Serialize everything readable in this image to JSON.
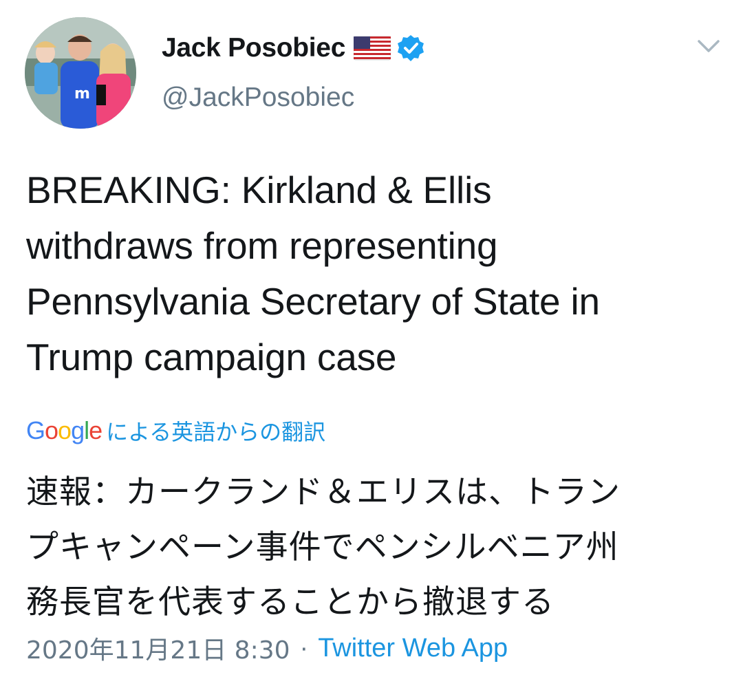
{
  "author": {
    "display_name": "Jack Posobiec",
    "handle": "@JackPosobiec",
    "flag_icon": "us-flag-icon",
    "verified_icon": "verified-badge-icon"
  },
  "tweet": {
    "text_lines": [
      "BREAKING: Kirkland & Ellis",
      "withdraws from representing",
      "Pennsylvania Secretary of State in",
      "Trump campaign case"
    ]
  },
  "translation": {
    "provider_letters": [
      "G",
      "o",
      "o",
      "g",
      "l",
      "e"
    ],
    "provider_colors": [
      "#4285f4",
      "#ea4335",
      "#fbbc05",
      "#4285f4",
      "#34a853",
      "#ea4335"
    ],
    "label": "による英語からの翻訳",
    "text_lines": [
      "速報：カークランド＆エリスは、トラン",
      "プキャンペーン事件でペンシルベニア州",
      "務長官を代表することから撤退する"
    ]
  },
  "meta": {
    "timestamp": "2020年11月21日 8:30",
    "separator": "·",
    "source": "Twitter Web App"
  },
  "colors": {
    "accent": "#1b95e0",
    "secondary_text": "#657786",
    "primary_text": "#14171a"
  }
}
